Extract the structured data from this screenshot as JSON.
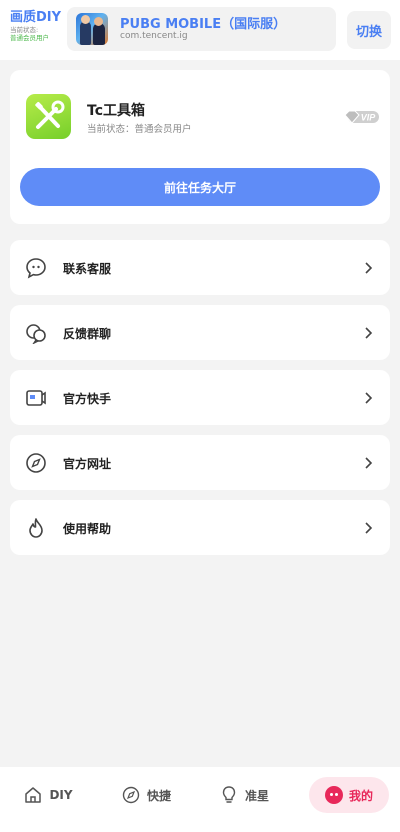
{
  "header": {
    "brand_title": "画质DIY",
    "brand_sub": "当前状态:",
    "brand_status": "普通会员用户",
    "game": {
      "name": "PUBG MOBILE（国际服）",
      "package": "com.tencent.ig"
    },
    "switch_label": "切换"
  },
  "profile": {
    "app_name": "Tc工具箱",
    "status": "当前状态：普通会员用户",
    "vip_label": "VIP",
    "task_button": "前往任务大厅"
  },
  "menu": [
    {
      "label": "联系客服",
      "icon": "chat-bubble-icon"
    },
    {
      "label": "反馈群聊",
      "icon": "group-chat-icon"
    },
    {
      "label": "官方快手",
      "icon": "video-camera-icon"
    },
    {
      "label": "官方网址",
      "icon": "compass-icon"
    },
    {
      "label": "使用帮助",
      "icon": "flame-icon"
    }
  ],
  "nav": [
    {
      "label": "DIY",
      "icon": "home-icon"
    },
    {
      "label": "快捷",
      "icon": "compass-icon"
    },
    {
      "label": "准星",
      "icon": "lightbulb-icon"
    },
    {
      "label": "我的",
      "icon": "face-icon",
      "active": true
    }
  ],
  "colors": {
    "accent": "#5f8cf7",
    "brand_blue": "#4a7ff3",
    "active_pink": "#e8285a",
    "status_green": "#4cb84c"
  }
}
